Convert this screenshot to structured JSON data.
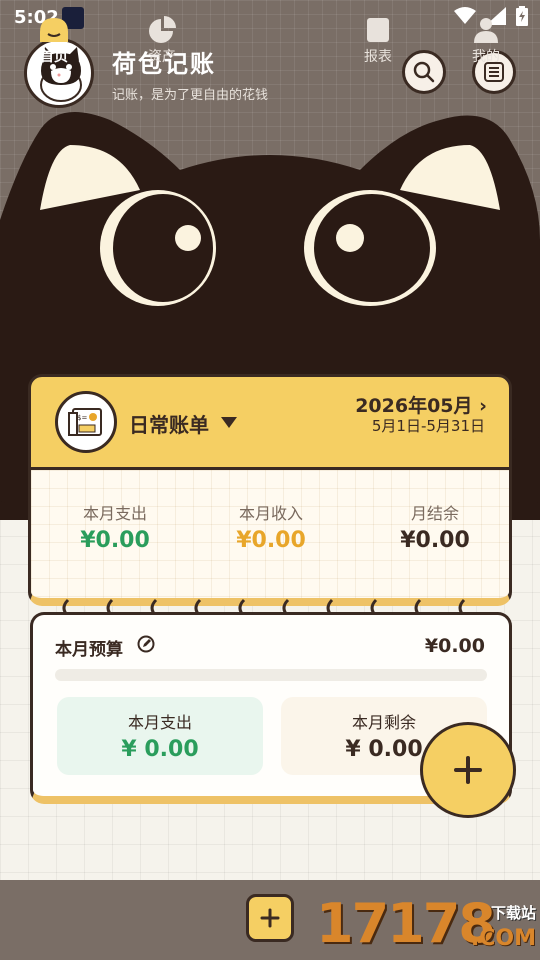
{
  "status_bar": {
    "time": "5:02"
  },
  "header": {
    "title": "荷包记账",
    "subtitle": "记账，是为了更自由的花钱"
  },
  "ledger": {
    "name": "日常账单",
    "month": "2026年05月",
    "range": "5月1日-5月31日",
    "stats": [
      {
        "label": "本月支出",
        "value": "¥0.00",
        "color": "#2a9d5c"
      },
      {
        "label": "本月收入",
        "value": "¥0.00",
        "color": "#e8a62a"
      },
      {
        "label": "月结余",
        "value": "¥0.00",
        "color": "#3a2a22"
      }
    ]
  },
  "budget": {
    "title": "本月预算",
    "value": "¥0.00",
    "progress": 0,
    "expense": {
      "label": "本月支出",
      "value": "¥ 0.00",
      "color": "#2a9d5c"
    },
    "remain": {
      "label": "本月剩余",
      "value": "¥ 0.00",
      "color": "#3a2a22"
    }
  },
  "nav": {
    "home": "首页",
    "assets": "资产",
    "reports": "报表",
    "mine": "我的"
  },
  "watermark": {
    "number": "17178",
    "top": "下载站",
    "com": ".COM"
  },
  "icons": [
    "search-icon",
    "list-icon",
    "edit-icon",
    "plus-icon",
    "home-icon",
    "pie-chart-icon",
    "report-icon",
    "user-icon",
    "wifi-icon",
    "signal-icon",
    "battery-icon"
  ]
}
